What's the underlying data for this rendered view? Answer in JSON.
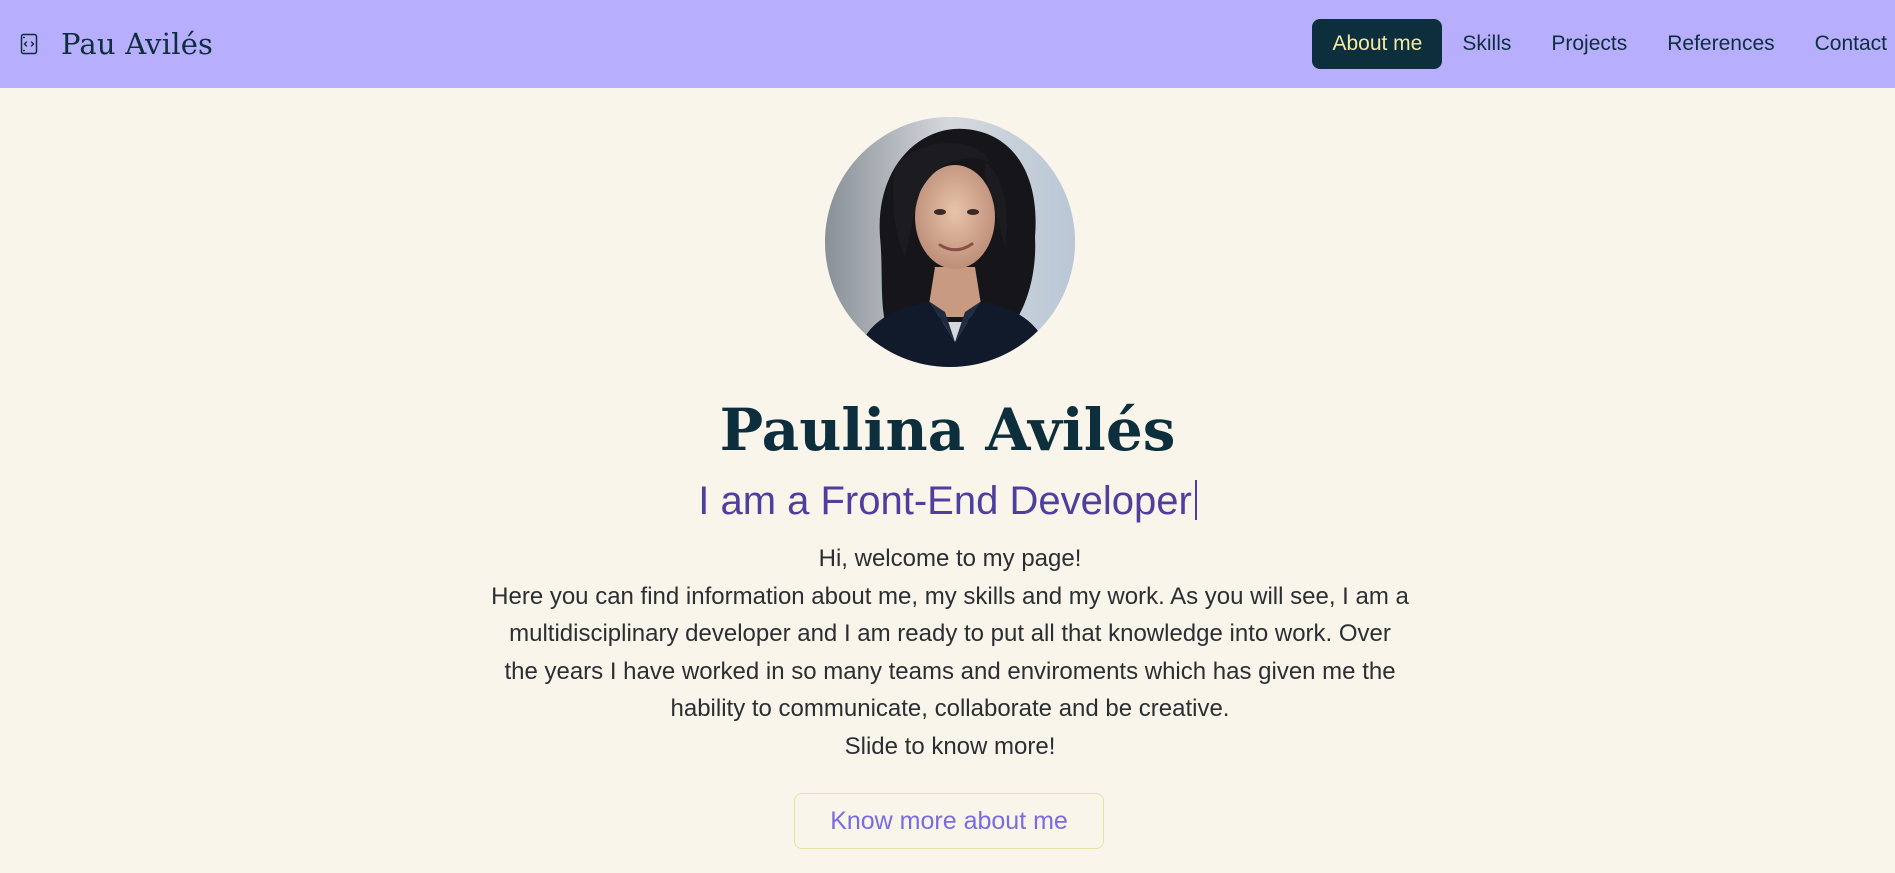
{
  "header": {
    "brand_name": "Pau Avilés",
    "brand_icon": "file-code-icon",
    "nav": [
      {
        "label": "About me",
        "active": true
      },
      {
        "label": "Skills",
        "active": false
      },
      {
        "label": "Projects",
        "active": false
      },
      {
        "label": "References",
        "active": false
      },
      {
        "label": "Contact",
        "active": false
      }
    ]
  },
  "hero": {
    "name": "Paulina Avilés",
    "tagline": "I am a Front-End Developer",
    "intro_lines": [
      "Hi, welcome to my page!",
      "Here you can find information about me, my skills and my work. As you will see, I am a multidisciplinary developer and I am ready to put all that knowledge into work. Over the years I have worked in so many teams and enviroments which has given me the hability to communicate, collaborate and be creative.",
      "Slide to know more!"
    ],
    "cta_label": "Know more about me"
  },
  "colors": {
    "navbar_bg": "#b7aefe",
    "page_bg": "#f9f5ea",
    "primary_dark": "#0d2f3d",
    "accent_purple": "#4e3e9e",
    "active_text": "#f3e9a1",
    "cta_text": "#7b6be0"
  }
}
